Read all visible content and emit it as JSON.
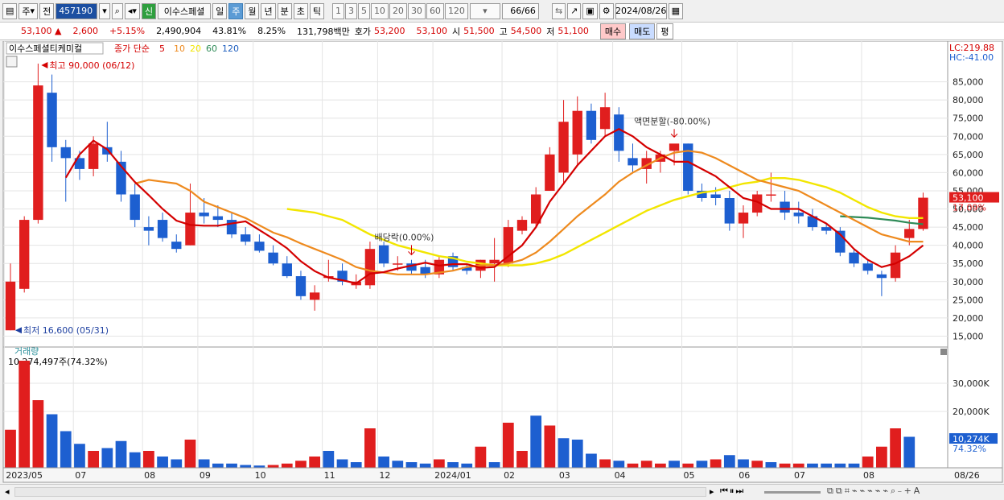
{
  "toolbar": {
    "market": "주",
    "all": "전",
    "code": "457190",
    "badge": "신",
    "name": "이수스페셜",
    "periods": [
      "일",
      "주",
      "월",
      "년",
      "분",
      "초",
      "틱"
    ],
    "selected_period": "주",
    "intervals": [
      "1",
      "3",
      "5",
      "10",
      "20",
      "30",
      "60",
      "120"
    ],
    "count": "66/66",
    "date": "2024/08/26"
  },
  "info": {
    "price": "53,100",
    "change": "2,600",
    "change_pct": "+5.15%",
    "volume": "2,490,904",
    "vol_ratio": "43.81%",
    "turnover": "8.25%",
    "amount": "131,798백만",
    "quote_label": "호가",
    "ask": "53,200",
    "bid": "53,100",
    "open_label": "시",
    "open": "51,500",
    "high_label": "고",
    "high": "54,500",
    "low_label": "저",
    "low": "51,100",
    "buy_label": "매수",
    "sell_label": "매도",
    "eval_label": "평"
  },
  "chart_data": {
    "type": "candlestick",
    "legend": {
      "name": "이수스페셜티케미컬",
      "ma_label": "종가 단순",
      "ma_periods": [
        "5",
        "10",
        "20",
        "60",
        "120"
      ],
      "ma_colors": [
        "#d40000",
        "#ee8a1e",
        "#f2e600",
        "#2e8b57",
        "#1f5fbf"
      ]
    },
    "lc_label": "LC:219.88",
    "hc_label": "HC:-41.00",
    "price_ticks": [
      "85,000",
      "80,000",
      "75,000",
      "70,000",
      "65,000",
      "60,000",
      "55,000",
      "50,000",
      "45,000",
      "40,000",
      "35,000",
      "30,000",
      "25,000",
      "20,000",
      "15,000"
    ],
    "price_ylim": [
      12000,
      94000
    ],
    "last_price_label": "53,100",
    "last_pct_label": "17.09%",
    "annotations": {
      "high": "최고 90,000 (06/12)",
      "low": "최저 16,600 (05/31)",
      "dividend": "배당락(0.00%)",
      "split": "액면분할(-80.00%)"
    },
    "x_labels": [
      "2023/05",
      "07",
      "08",
      "09",
      "10",
      "11",
      "12",
      "2024/01",
      "02",
      "03",
      "04",
      "05",
      "06",
      "07",
      "08",
      "08/26"
    ],
    "x_label_index": [
      0,
      5,
      10,
      14,
      18,
      23,
      27,
      31,
      36,
      40,
      44,
      49,
      53,
      57,
      62,
      68
    ],
    "candles": [
      {
        "o": 16600,
        "h": 35000,
        "l": 16600,
        "c": 30000
      },
      {
        "o": 28000,
        "h": 48000,
        "l": 27000,
        "c": 47000
      },
      {
        "o": 47000,
        "h": 90000,
        "l": 46000,
        "c": 84000
      },
      {
        "o": 82000,
        "h": 87000,
        "l": 63000,
        "c": 67000
      },
      {
        "o": 67000,
        "h": 69000,
        "l": 52000,
        "c": 64000
      },
      {
        "o": 64000,
        "h": 66000,
        "l": 58000,
        "c": 61000
      },
      {
        "o": 61000,
        "h": 70000,
        "l": 59000,
        "c": 68000
      },
      {
        "o": 67000,
        "h": 74000,
        "l": 63000,
        "c": 65000
      },
      {
        "o": 63000,
        "h": 66000,
        "l": 52000,
        "c": 54000
      },
      {
        "o": 54000,
        "h": 57000,
        "l": 45000,
        "c": 47000
      },
      {
        "o": 45000,
        "h": 48000,
        "l": 40000,
        "c": 44000
      },
      {
        "o": 47000,
        "h": 49000,
        "l": 41000,
        "c": 42000
      },
      {
        "o": 41000,
        "h": 43000,
        "l": 38000,
        "c": 39000
      },
      {
        "o": 40000,
        "h": 57000,
        "l": 40000,
        "c": 49000
      },
      {
        "o": 49000,
        "h": 53000,
        "l": 46000,
        "c": 48000
      },
      {
        "o": 48000,
        "h": 51000,
        "l": 45000,
        "c": 47000
      },
      {
        "o": 47000,
        "h": 49000,
        "l": 42000,
        "c": 43000
      },
      {
        "o": 43000,
        "h": 45000,
        "l": 40000,
        "c": 41000
      },
      {
        "o": 41000,
        "h": 43000,
        "l": 38000,
        "c": 38500
      },
      {
        "o": 38000,
        "h": 40000,
        "l": 34500,
        "c": 35000
      },
      {
        "o": 35000,
        "h": 37000,
        "l": 31000,
        "c": 31500
      },
      {
        "o": 31500,
        "h": 33000,
        "l": 25000,
        "c": 26000
      },
      {
        "o": 25000,
        "h": 29000,
        "l": 22000,
        "c": 27000
      },
      {
        "o": 31000,
        "h": 36000,
        "l": 30000,
        "c": 31500
      },
      {
        "o": 33000,
        "h": 35000,
        "l": 29000,
        "c": 30000
      },
      {
        "o": 29000,
        "h": 32000,
        "l": 28000,
        "c": 30000
      },
      {
        "o": 29000,
        "h": 41000,
        "l": 28000,
        "c": 39000
      },
      {
        "o": 40000,
        "h": 41000,
        "l": 34000,
        "c": 35000
      },
      {
        "o": 35000,
        "h": 37000,
        "l": 33000,
        "c": 35000
      },
      {
        "o": 35000,
        "h": 36000,
        "l": 32000,
        "c": 33000
      },
      {
        "o": 34000,
        "h": 36000,
        "l": 31000,
        "c": 32000
      },
      {
        "o": 32000,
        "h": 37000,
        "l": 31000,
        "c": 36000
      },
      {
        "o": 37000,
        "h": 38000,
        "l": 33000,
        "c": 34000
      },
      {
        "o": 34000,
        "h": 35000,
        "l": 32000,
        "c": 33000
      },
      {
        "o": 33000,
        "h": 36000,
        "l": 31000,
        "c": 36000
      },
      {
        "o": 35000,
        "h": 42000,
        "l": 30000,
        "c": 36000
      },
      {
        "o": 35000,
        "h": 47000,
        "l": 34000,
        "c": 45000
      },
      {
        "o": 44000,
        "h": 48000,
        "l": 43000,
        "c": 47000
      },
      {
        "o": 46000,
        "h": 56000,
        "l": 45000,
        "c": 54000
      },
      {
        "o": 55000,
        "h": 67000,
        "l": 55000,
        "c": 65000
      },
      {
        "o": 60000,
        "h": 80000,
        "l": 57000,
        "c": 74000
      },
      {
        "o": 65000,
        "h": 81000,
        "l": 62000,
        "c": 77000
      },
      {
        "o": 77000,
        "h": 79000,
        "l": 68000,
        "c": 69000
      },
      {
        "o": 72000,
        "h": 82000,
        "l": 70000,
        "c": 78000
      },
      {
        "o": 76000,
        "h": 78000,
        "l": 63000,
        "c": 66000
      },
      {
        "o": 64000,
        "h": 68000,
        "l": 60000,
        "c": 62000
      },
      {
        "o": 61000,
        "h": 66000,
        "l": 57000,
        "c": 64000
      },
      {
        "o": 63000,
        "h": 66000,
        "l": 60000,
        "c": 65000
      },
      {
        "o": 66000,
        "h": 67000,
        "l": 62000,
        "c": 68000
      },
      {
        "o": 68000,
        "h": 68000,
        "l": 54000,
        "c": 55000
      },
      {
        "o": 55000,
        "h": 57000,
        "l": 52000,
        "c": 53000
      },
      {
        "o": 54000,
        "h": 56000,
        "l": 51000,
        "c": 53000
      },
      {
        "o": 53000,
        "h": 55000,
        "l": 44000,
        "c": 46000
      },
      {
        "o": 46000,
        "h": 51000,
        "l": 42000,
        "c": 49000
      },
      {
        "o": 49000,
        "h": 55000,
        "l": 48000,
        "c": 54000
      },
      {
        "o": 54000,
        "h": 60000,
        "l": 52000,
        "c": 54000
      },
      {
        "o": 52000,
        "h": 55000,
        "l": 47000,
        "c": 49000
      },
      {
        "o": 49000,
        "h": 52000,
        "l": 46000,
        "c": 48000
      },
      {
        "o": 48000,
        "h": 50000,
        "l": 44000,
        "c": 45000
      },
      {
        "o": 45000,
        "h": 46000,
        "l": 43000,
        "c": 44000
      },
      {
        "o": 44000,
        "h": 45000,
        "l": 37000,
        "c": 38000
      },
      {
        "o": 38000,
        "h": 39000,
        "l": 34000,
        "c": 35000
      },
      {
        "o": 35000,
        "h": 36000,
        "l": 32000,
        "c": 33000
      },
      {
        "o": 32000,
        "h": 33000,
        "l": 26000,
        "c": 31000
      },
      {
        "o": 31000,
        "h": 40000,
        "l": 30000,
        "c": 38000
      },
      {
        "o": 42000,
        "h": 47000,
        "l": 40000,
        "c": 44500
      },
      {
        "o": 44500,
        "h": 54500,
        "l": 44000,
        "c": 53100
      }
    ],
    "ma5": [
      null,
      null,
      null,
      null,
      58600,
      65000,
      68800,
      66400,
      61800,
      57400,
      53800,
      50000,
      46800,
      45600,
      45400,
      45400,
      46000,
      46600,
      44200,
      41800,
      39200,
      35600,
      32900,
      31100,
      30400,
      29500,
      32200,
      32600,
      33600,
      34400,
      35200,
      34400,
      34800,
      34800,
      33800,
      34000,
      37000,
      40000,
      45000,
      52000,
      57000,
      62000,
      66000,
      70000,
      72000,
      70000,
      67000,
      65000,
      63000,
      63000,
      61000,
      59000,
      56000,
      53000,
      52000,
      50000,
      50000,
      50000,
      48000,
      46000,
      43000,
      39000,
      36000,
      34000,
      35000,
      37000,
      40000
    ],
    "ma10": [
      null,
      null,
      null,
      null,
      null,
      null,
      null,
      null,
      null,
      57000,
      58000,
      57500,
      57000,
      55000,
      52000,
      50500,
      49000,
      47500,
      45500,
      43500,
      42200,
      40500,
      39000,
      37500,
      36000,
      34000,
      33000,
      32500,
      32000,
      32000,
      32000,
      32500,
      33000,
      34000,
      34500,
      34500,
      35000,
      36000,
      38000,
      41000,
      44500,
      48000,
      51000,
      54000,
      57500,
      60000,
      62000,
      64000,
      65500,
      66000,
      65500,
      64000,
      62000,
      60000,
      58000,
      57000,
      56000,
      55000,
      53000,
      51000,
      49000,
      47000,
      45000,
      43000,
      42000,
      41000,
      41000
    ],
    "ma20": [
      null,
      null,
      null,
      null,
      null,
      null,
      null,
      null,
      null,
      null,
      null,
      null,
      null,
      null,
      null,
      null,
      null,
      null,
      null,
      null,
      50000,
      49500,
      49000,
      48000,
      47000,
      45000,
      43000,
      41500,
      40000,
      39000,
      38000,
      37000,
      36500,
      35500,
      35000,
      34500,
      34500,
      34500,
      35000,
      36000,
      37500,
      39500,
      41500,
      43500,
      45500,
      47500,
      49500,
      51000,
      52500,
      53500,
      54500,
      55000,
      56000,
      57000,
      57500,
      58500,
      58500,
      58000,
      57000,
      56000,
      54500,
      52500,
      50500,
      49000,
      48000,
      47500,
      47500
    ],
    "ma60": [
      null,
      null,
      null,
      null,
      null,
      null,
      null,
      null,
      null,
      null,
      null,
      null,
      null,
      null,
      null,
      null,
      null,
      null,
      null,
      null,
      null,
      null,
      null,
      null,
      null,
      null,
      null,
      null,
      null,
      null,
      null,
      null,
      null,
      null,
      null,
      null,
      null,
      null,
      null,
      null,
      null,
      null,
      null,
      null,
      null,
      null,
      null,
      null,
      null,
      null,
      null,
      null,
      null,
      null,
      null,
      null,
      null,
      null,
      null,
      null,
      48000,
      47800,
      47600,
      47200,
      46800,
      46200,
      45800
    ],
    "volume_label": "거래량",
    "volume_info": "10,274,497주(74.32%)",
    "volume_ticks": [
      "30,000K",
      "20,000K"
    ],
    "volume_ylim": [
      0,
      40000
    ],
    "last_volume_label": "10,274K",
    "last_volume_pct": "74.32%",
    "volume": [
      13500,
      38000,
      24000,
      19000,
      13000,
      8500,
      6000,
      7000,
      9500,
      5500,
      6000,
      4000,
      3000,
      10000,
      3000,
      1500,
      1500,
      1000,
      800,
      1000,
      1500,
      2500,
      4000,
      6000,
      3000,
      2000,
      14000,
      4000,
      2500,
      2000,
      1500,
      3000,
      2000,
      1500,
      7500,
      2000,
      16000,
      6000,
      18500,
      15000,
      10500,
      10000,
      5000,
      3000,
      2500,
      1500,
      2500,
      1500,
      2500,
      1500,
      2500,
      3000,
      4500,
      3000,
      2500,
      2000,
      1500,
      1500,
      1500,
      1500,
      1500,
      1500,
      4000,
      7500,
      14000,
      11000
    ],
    "volume_up": [
      true,
      true,
      true,
      false,
      false,
      false,
      true,
      false,
      false,
      false,
      true,
      false,
      false,
      true,
      false,
      false,
      false,
      false,
      false,
      true,
      true,
      true,
      true,
      false,
      false,
      false,
      true,
      false,
      false,
      false,
      false,
      true,
      false,
      false,
      true,
      false,
      true,
      true,
      false,
      true,
      false,
      false,
      false,
      true,
      false,
      true,
      true,
      true,
      false,
      true,
      false,
      true,
      false,
      false,
      true,
      false,
      true,
      true,
      false,
      false,
      false,
      false,
      true,
      true,
      true,
      false
    ]
  }
}
